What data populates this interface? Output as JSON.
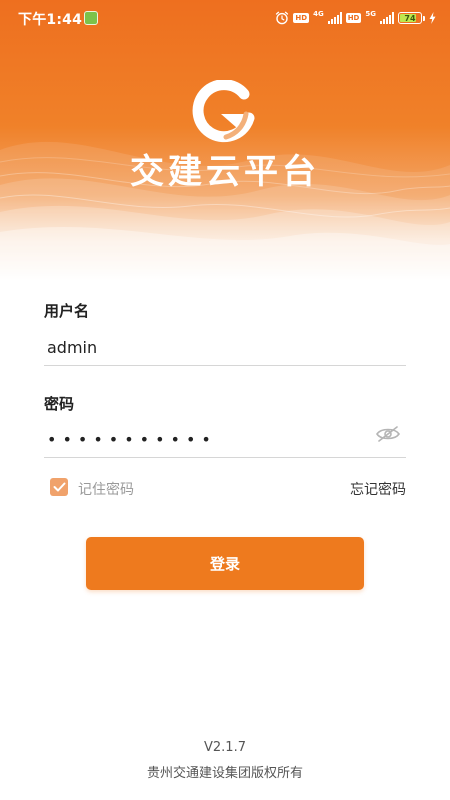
{
  "status_bar": {
    "time": "下午1:44",
    "hd_badge_1": "HD",
    "network_1": "4G",
    "hd_badge_2": "HD",
    "network_2": "5G",
    "battery_level": "74"
  },
  "brand": {
    "app_name": "交建云平台",
    "primary_color": "#ee6f1f",
    "button_color": "#ee7a1e",
    "checkbox_color": "#f0a26b"
  },
  "form": {
    "username_label": "用户名",
    "username_value": "admin",
    "password_label": "密码",
    "password_value": "***********",
    "remember_checked": true,
    "remember_label": "记住密码",
    "forgot_label": "忘记密码",
    "login_label": "登录"
  },
  "footer": {
    "version": "V2.1.7",
    "copyright": "贵州交通建设集团版权所有"
  }
}
